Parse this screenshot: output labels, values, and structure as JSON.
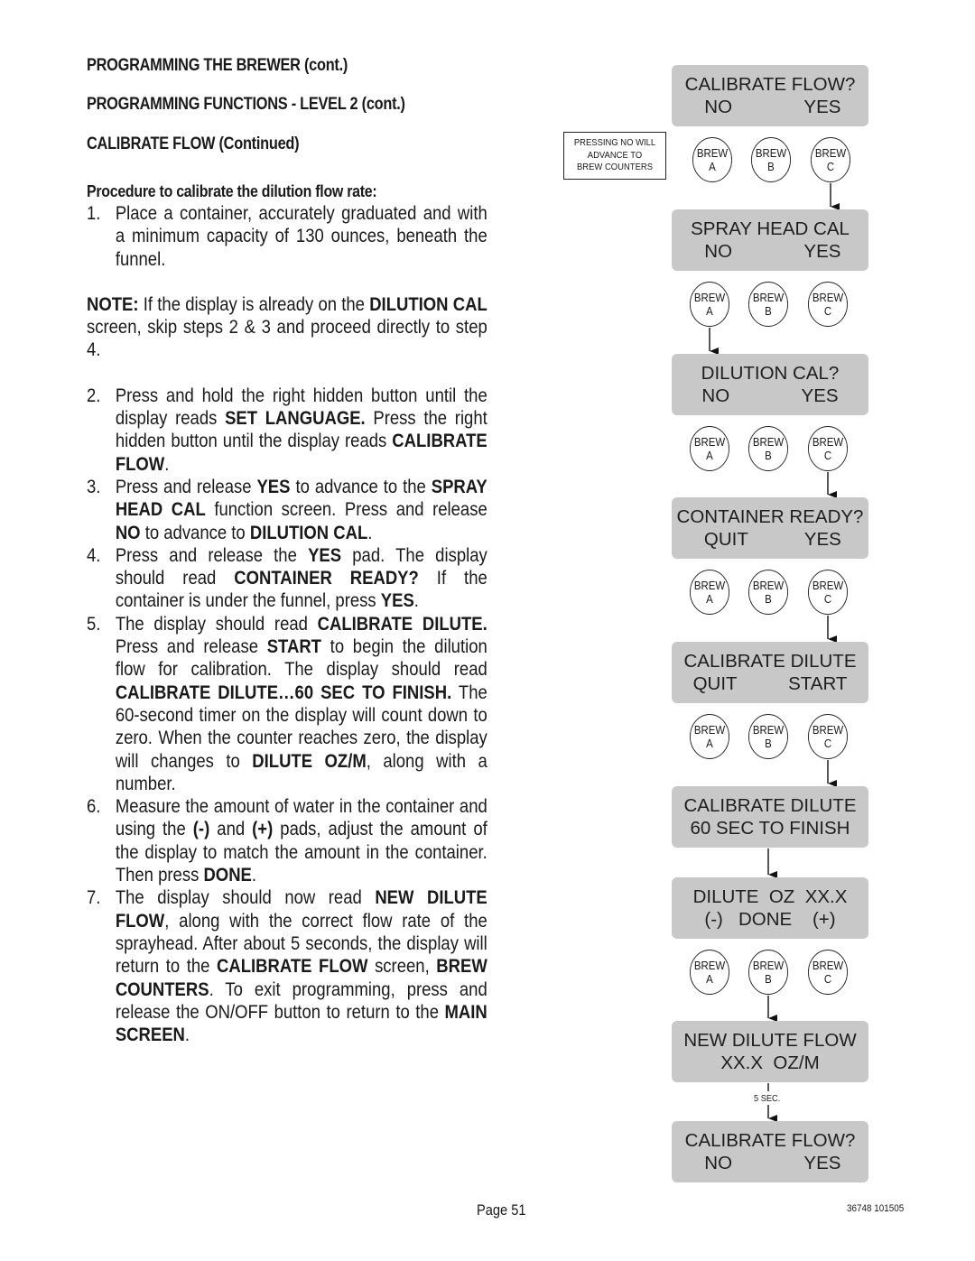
{
  "headings": {
    "h1": "PROGRAMMING THE BREWER (cont.)",
    "h2": "PROGRAMMING FUNCTIONS - LEVEL  2 (cont.)",
    "h3": "CALIBRATE FLOW (Continued)",
    "h4": "Procedure to calibrate the dilution flow rate:"
  },
  "steps": {
    "s1": {
      "num": "1.",
      "text": "Place a container, accurately graduated and with a minimum capacity of 130 ounces, beneath the funnel."
    },
    "note": {
      "label": "NOTE:",
      "t1": " If the display is already on the ",
      "b1": "DILUTION CAL",
      "t2": " screen, skip steps 2 & 3 and proceed directly to step 4."
    },
    "s2": {
      "num": "2.",
      "t1": "Press and hold the right hidden button until the display reads ",
      "b1": "SET LANGUAGE.",
      "t2": " Press the right hidden button until the display reads ",
      "b2": "CALIBRATE FLOW",
      "t3": "."
    },
    "s3": {
      "num": "3.",
      "t1": "Press and release ",
      "b1": "YES",
      "t2": " to advance to the ",
      "b2": "SPRAY HEAD CAL",
      "t3": " function screen. Press and release ",
      "b3": "NO",
      "t4": " to advance to ",
      "b4": "DILUTION CAL",
      "t5": "."
    },
    "s4": {
      "num": "4.",
      "t1": "Press and release the ",
      "b1": "YES",
      "t2": " pad. The display should read ",
      "b2": "CONTAINER READY?",
      "t3": "  If the container is under the funnel, press ",
      "b3": "YES",
      "t4": "."
    },
    "s5": {
      "num": "5.",
      "t1": "The display should read ",
      "b1": "CALIBRATE DILUTE.",
      "t2": " Press and release ",
      "b2": "START",
      "t3": " to begin the dilution flow for calibration. The display should read ",
      "b3": "CALIBRATE DILUTE…60 SEC TO FINISH.",
      "t4": " The 60-second timer on the display will count down to zero. When the counter reaches zero, the display will changes to ",
      "b4": "DILUTE OZ/M",
      "t5": ", along with a number."
    },
    "s6": {
      "num": "6.",
      "t1": "Measure the amount of water in the container and using the ",
      "b1": "(-)",
      "t2": " and ",
      "b2": "(+)",
      "t3": " pads, adjust the amount of the display to match the amount in the container. Then press ",
      "b3": "DONE",
      "t4": "."
    },
    "s7": {
      "num": "7.",
      "t1": "The display should now read ",
      "b1": "NEW DILUTE FLOW",
      "t2": ", along with the correct flow rate of the sprayhead. After about 5 seconds, the display will return to the ",
      "b2": "CALIBRATE FLOW",
      "t3": " screen, ",
      "b3": "BREW COUNTERS",
      "t4": ". To exit programming, press and release the ON/OFF button to return to the ",
      "b4": "MAIN SCREEN",
      "t5": "."
    }
  },
  "diagram": {
    "side_note": [
      "PRESSING NO WILL",
      "ADVANCE TO",
      "BREW COUNTERS"
    ],
    "buttons": {
      "a": [
        "BREW",
        "A"
      ],
      "b": [
        "BREW",
        "B"
      ],
      "c": [
        "BREW",
        "C"
      ]
    },
    "screens": [
      {
        "line1": "CALIBRATE FLOW?",
        "line2": " NO              YES"
      },
      {
        "line1": "SPRAY HEAD CAL",
        "line2": " NO              YES"
      },
      {
        "line1": "DILUTION CAL?",
        "line2": "NO              YES"
      },
      {
        "line1": "CONTAINER READY?",
        "line2": " QUIT           YES"
      },
      {
        "line1": "CALIBRATE DILUTE",
        "line2": "QUIT          START"
      },
      {
        "line1": "CALIBRATE DILUTE",
        "line2": "60 SEC TO FINISH"
      },
      {
        "line1": "DILUTE  OZ  XX.X",
        "line2": "(-)   DONE    (+)"
      },
      {
        "line1": "NEW DILUTE FLOW",
        "line2": "XX.X  OZ/M"
      },
      {
        "line1": "CALIBRATE FLOW?",
        "line2": " NO              YES"
      }
    ],
    "delay_label": "5 SEC."
  },
  "footer": {
    "page": "Page 51",
    "code": "36748 101505"
  }
}
